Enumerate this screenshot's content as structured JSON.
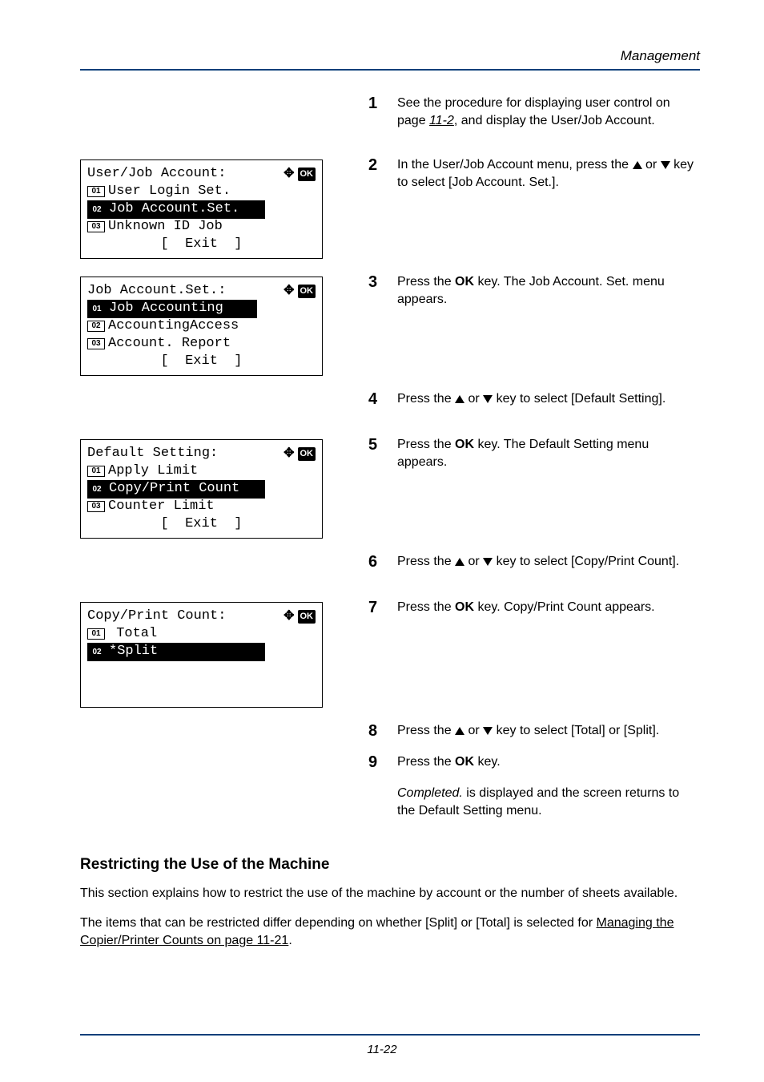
{
  "header": {
    "section": "Management"
  },
  "lcd1": {
    "title": "User/Job Account:",
    "n1": "01",
    "l1": "User Login Set.",
    "n2": "02",
    "l2": "Job Account.Set.",
    "n3": "03",
    "l3": "Unknown ID Job",
    "exit": "[  Exit  ]"
  },
  "lcd2": {
    "title": "Job Account.Set.:",
    "n1": "01",
    "l1": "Job Accounting",
    "n2": "02",
    "l2": "AccountingAccess",
    "n3": "03",
    "l3": "Account. Report",
    "exit": "[  Exit  ]"
  },
  "lcd3": {
    "title": "Default Setting:",
    "n1": "01",
    "l1": "Apply Limit",
    "n2": "02",
    "l2": "Copy/Print Count",
    "n3": "03",
    "l3": "Counter Limit",
    "exit": "[  Exit  ]"
  },
  "lcd4": {
    "title": "Copy/Print Count:",
    "n1": "01",
    "l1": " Total",
    "n2": "02",
    "l2": "*Split"
  },
  "ok": "OK",
  "nav": "✥",
  "steps": {
    "s1a": "See the procedure for displaying user control on page ",
    "s1link": "11-2",
    "s1b": ", and display the User/Job Account.",
    "s2": "In the User/Job Account menu, press the ",
    "s2b": " key to select [Job Account. Set.].",
    "s3a": "Press the ",
    "s3ok": "OK",
    "s3b": " key. The Job Account. Set. menu appears.",
    "s4a": "Press the ",
    "s4b": " key to select [Default Setting].",
    "s5a": "Press the ",
    "s5b": " key. The Default Setting menu appears.",
    "s6a": "Press the ",
    "s6b": " key to select [Copy/Print Count].",
    "s7a": "Press the ",
    "s7b": " key. Copy/Print Count appears.",
    "s8a": "Press the ",
    "s8b": " key to select [Total] or [Split].",
    "s9a": "Press the ",
    "s9b": " key.",
    "s9c": "Completed.",
    "s9d": " is displayed and the screen returns to the Default Setting menu.",
    "or": " or "
  },
  "section": {
    "h2": "Restricting the Use of the Machine",
    "p1": "This section explains how to restrict the use of the machine by account or the number of sheets available.",
    "p2a": "The items that can be restricted differ depending on whether [Split] or [Total] is selected for ",
    "p2link": "Managing the Copier/Printer Counts on page 11-21",
    "p2b": "."
  },
  "pagenum": "11-22"
}
